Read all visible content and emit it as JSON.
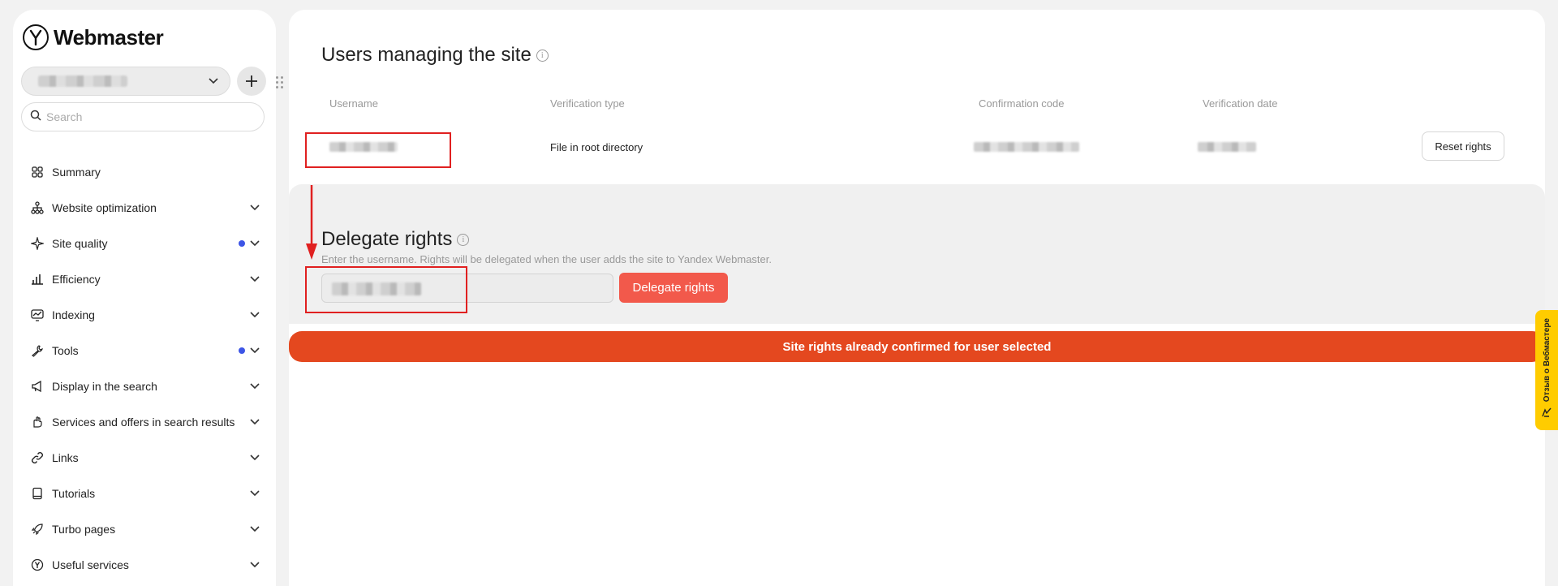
{
  "brand": {
    "name": "Webmaster",
    "logo_letter": "Y"
  },
  "site_selector": {
    "value_blurred": true
  },
  "search": {
    "placeholder": "Search"
  },
  "sidebar": {
    "items": [
      {
        "label": "Summary",
        "icon": "grid-icon",
        "chevron": false,
        "dot": false
      },
      {
        "label": "Website optimization",
        "icon": "sitemap-icon",
        "chevron": true,
        "dot": false
      },
      {
        "label": "Site quality",
        "icon": "sparkle-icon",
        "chevron": true,
        "dot": true
      },
      {
        "label": "Efficiency",
        "icon": "bar-chart-icon",
        "chevron": true,
        "dot": false
      },
      {
        "label": "Indexing",
        "icon": "monitor-chart-icon",
        "chevron": true,
        "dot": false
      },
      {
        "label": "Tools",
        "icon": "wrench-icon",
        "chevron": true,
        "dot": true
      },
      {
        "label": "Display in the search",
        "icon": "megaphone-icon",
        "chevron": true,
        "dot": false
      },
      {
        "label": "Services and offers in search results",
        "icon": "hand-icon",
        "chevron": true,
        "dot": false
      },
      {
        "label": "Links",
        "icon": "link-icon",
        "chevron": true,
        "dot": false
      },
      {
        "label": "Tutorials",
        "icon": "book-icon",
        "chevron": true,
        "dot": false
      },
      {
        "label": "Turbo pages",
        "icon": "rocket-icon",
        "chevron": true,
        "dot": false
      },
      {
        "label": "Useful services",
        "icon": "yandex-icon",
        "chevron": true,
        "dot": false
      }
    ]
  },
  "users_section": {
    "title": "Users managing the site",
    "columns": [
      "Username",
      "Verification type",
      "Confirmation code",
      "Verification date"
    ],
    "rows": [
      {
        "verification_type": "File in root directory",
        "action": "Reset rights"
      }
    ]
  },
  "delegate_section": {
    "title": "Delegate rights",
    "hint": "Enter the username. Rights will be delegated when the user adds the site to Yandex Webmaster.",
    "button": "Delegate rights"
  },
  "toast": {
    "message": "Site rights already confirmed for user selected"
  },
  "feedback_tab": {
    "label": "Отзыв о Вебмастере"
  },
  "colors": {
    "accent": "#f2594b",
    "toast": "#e4481f",
    "dot": "#3d55e6",
    "highlight": "#e02020",
    "feedback": "#ffcc00"
  }
}
